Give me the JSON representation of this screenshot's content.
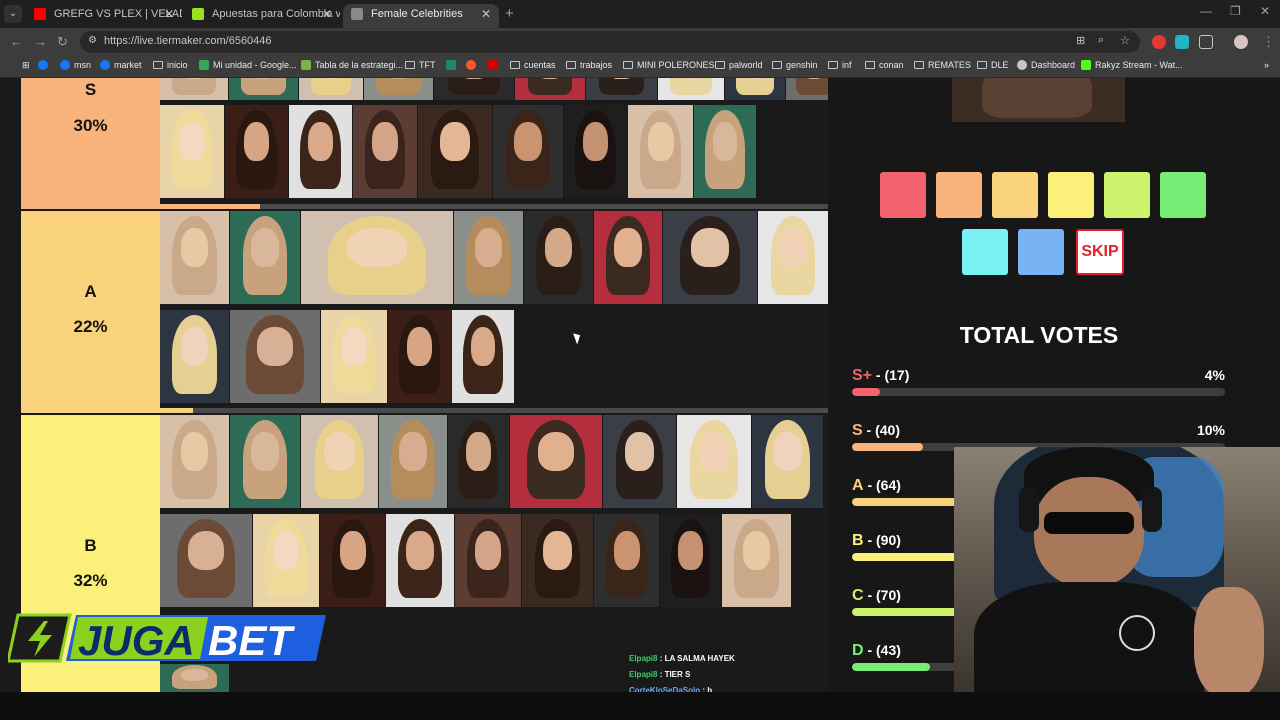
{
  "browser": {
    "tabs": [
      {
        "title": "GREFG VS PLEX | VELADA DEL A",
        "active": false,
        "favicon_color": "#ff0000"
      },
      {
        "title": "Apuestas para Colombia vs Fra",
        "active": false,
        "favicon_color": "#9be11d"
      },
      {
        "title": "Female Celebrities",
        "active": true,
        "favicon_color": "#e8eaed"
      }
    ],
    "url": "https://live.tiermaker.com/6560446",
    "bookmarks": [
      {
        "label": "",
        "icon": "facebook-icon"
      },
      {
        "label": "msn",
        "icon": "facebook-icon"
      },
      {
        "label": "market",
        "icon": "facebook-icon"
      },
      {
        "label": "inicio",
        "icon": "folder-icon"
      },
      {
        "label": "Mi unidad - Google...",
        "icon": "drive-icon"
      },
      {
        "label": "Tabla de la estrategi...",
        "icon": "chess-icon"
      },
      {
        "label": "TFT",
        "icon": "folder-icon"
      },
      {
        "label": "",
        "icon": "game-icon"
      },
      {
        "label": "",
        "icon": "game-icon"
      },
      {
        "label": "",
        "icon": "game-icon"
      },
      {
        "label": "cuentas",
        "icon": "folder-icon"
      },
      {
        "label": "trabajos",
        "icon": "folder-icon"
      },
      {
        "label": "MINI POLERONES",
        "icon": "folder-icon"
      },
      {
        "label": "palworld",
        "icon": "folder-icon"
      },
      {
        "label": "genshin",
        "icon": "folder-icon"
      },
      {
        "label": "inf",
        "icon": "folder-icon"
      },
      {
        "label": "conan",
        "icon": "folder-icon"
      },
      {
        "label": "REMATES",
        "icon": "folder-icon"
      },
      {
        "label": "DLE",
        "icon": "folder-icon"
      },
      {
        "label": "Dashboard",
        "icon": "globe-icon"
      },
      {
        "label": "Rakyz Stream - Wat...",
        "icon": "kick-icon"
      }
    ]
  },
  "tiers": [
    {
      "name": "S",
      "percent": "30%",
      "color": "#f8b47c",
      "bar_fill": 0.15,
      "bar_color": "#f8b47c"
    },
    {
      "name": "A",
      "percent": "22%",
      "color": "#f9d27b",
      "bar_fill": 0.05,
      "bar_color": "#f9d27b"
    },
    {
      "name": "B",
      "percent": "32%",
      "color": "#fbf07a",
      "bar_fill": 0,
      "bar_color": "#fbf07a"
    }
  ],
  "vote_buttons": [
    "#f2636e",
    "#f8b47c",
    "#f9d27b",
    "#fbf07a",
    "#cdf26c",
    "#77ed76",
    "#78f0f4",
    "#78b3f6"
  ],
  "skip_label": "SKIP",
  "votes": {
    "title": "TOTAL VOTES",
    "rows": [
      {
        "tier": "S+",
        "count": "- (17)",
        "percent": "4%",
        "fraction": 0.04,
        "color": "#f2636e"
      },
      {
        "tier": "S",
        "count": "- (40)",
        "percent": "10%",
        "fraction": 0.1,
        "color": "#f8b47c"
      },
      {
        "tier": "A",
        "count": "- (64)",
        "percent": "",
        "fraction": 0.16,
        "color": "#f9d27b"
      },
      {
        "tier": "B",
        "count": "- (90)",
        "percent": "",
        "fraction": 0.22,
        "color": "#fbf07a"
      },
      {
        "tier": "C",
        "count": "- (70)",
        "percent": "",
        "fraction": 0.17,
        "color": "#cdf26c"
      },
      {
        "tier": "D",
        "count": "- (43)",
        "percent": "",
        "fraction": 0.11,
        "color": "#77ed76"
      }
    ]
  },
  "chat": [
    {
      "user": "Elpapi8",
      "message": ": LA SALMA HAYEK",
      "user_color": "green"
    },
    {
      "user": "Elpapi8",
      "message": ": TIER S",
      "user_color": "green"
    },
    {
      "user": "CorteKloSeDaSolo",
      "message": ": b",
      "user_color": "blue"
    }
  ],
  "logo": {
    "part1": "JUGA",
    "part2": "BET"
  }
}
